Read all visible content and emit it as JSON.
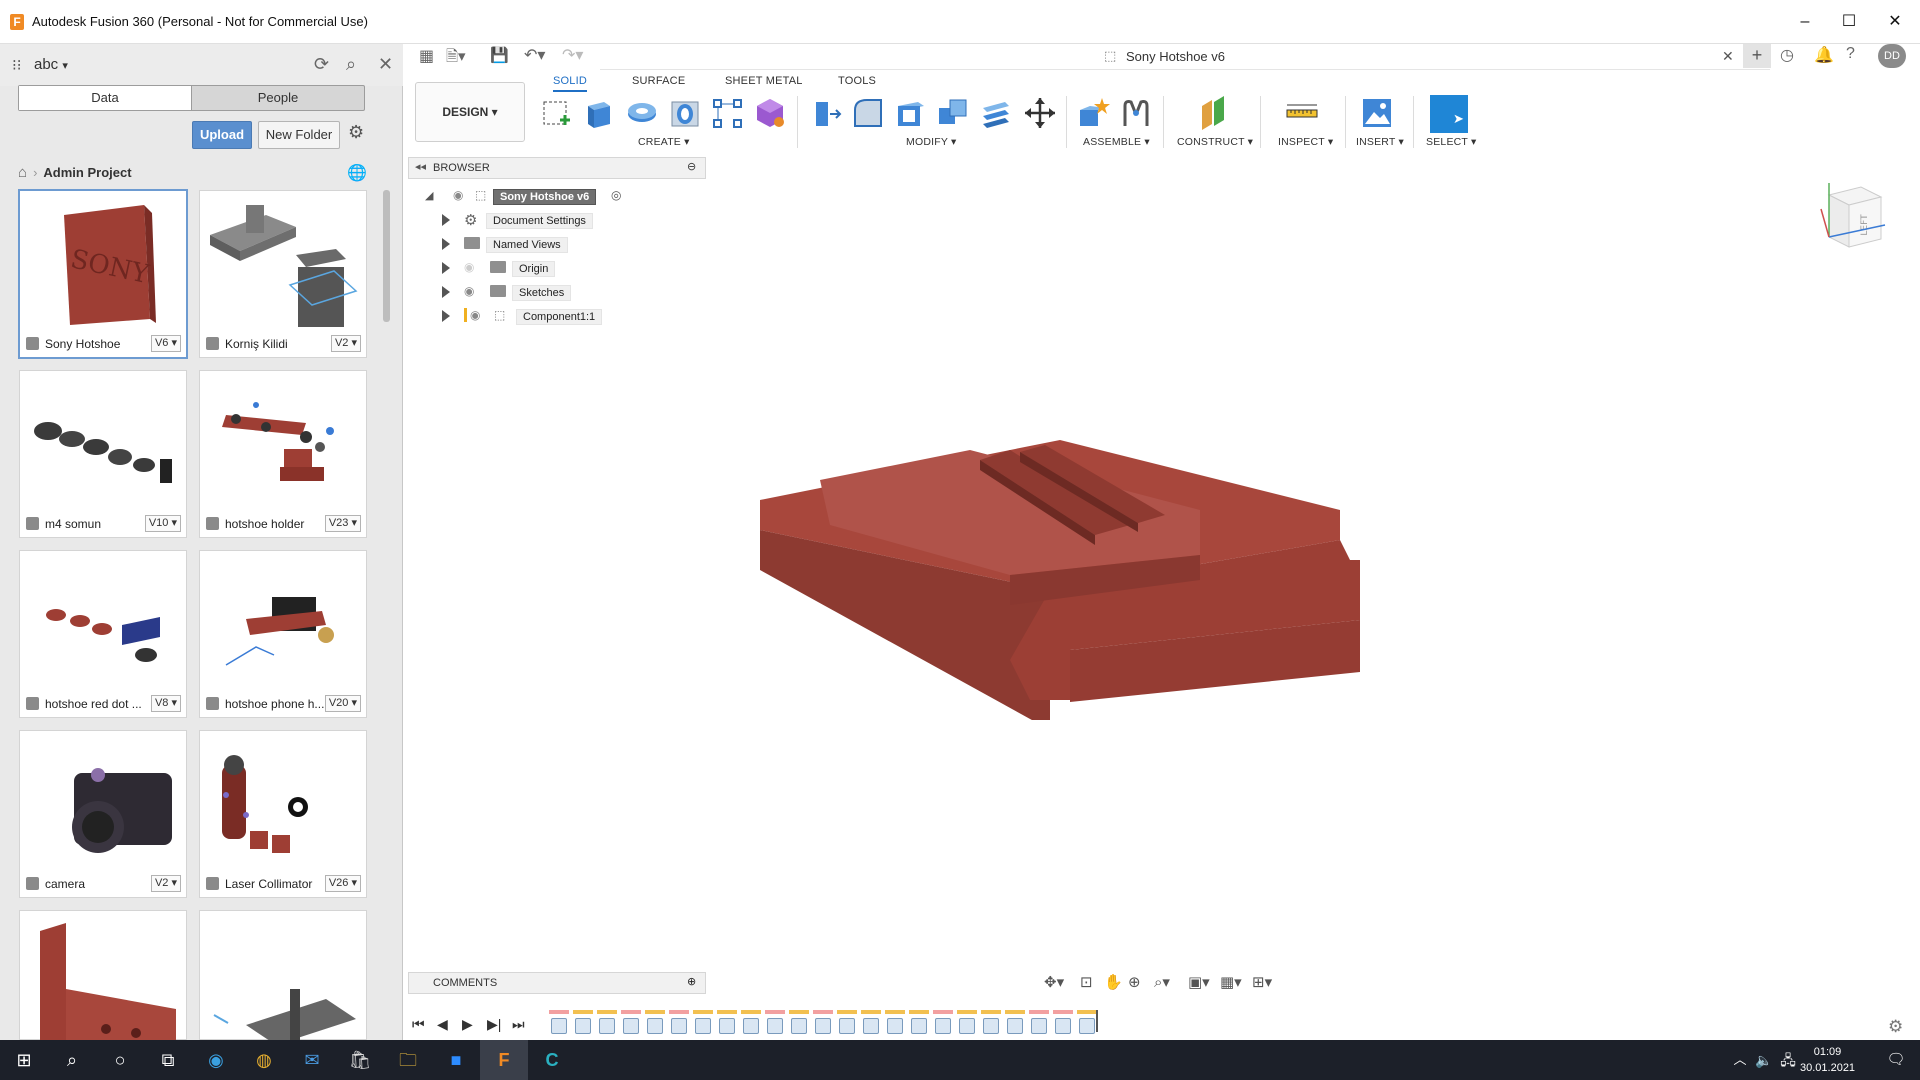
{
  "window": {
    "title": "Autodesk Fusion 360 (Personal - Not for Commercial Use)",
    "app_icon": "F",
    "minimize": "–",
    "maximize": "☐",
    "close": "✕"
  },
  "data_panel": {
    "hub_name": "abc",
    "tabs": [
      "Data",
      "People"
    ],
    "upload_label": "Upload",
    "new_folder_label": "New Folder",
    "breadcrumb_project": "Admin Project",
    "files": [
      {
        "name": "Sony Hotshoe",
        "version": "V6"
      },
      {
        "name": "Korniş Kilidi",
        "version": "V2"
      },
      {
        "name": "m4 somun",
        "version": "V10"
      },
      {
        "name": "hotshoe holder",
        "version": "V23"
      },
      {
        "name": "hotshoe red dot ...",
        "version": "V8"
      },
      {
        "name": "hotshoe phone h...",
        "version": "V20"
      },
      {
        "name": "camera",
        "version": "V2"
      },
      {
        "name": "Laser Collimator",
        "version": "V26"
      }
    ]
  },
  "document": {
    "title": "Sony Hotshoe v6",
    "avatar_initials": "DD"
  },
  "toolbar": {
    "workspace": "DESIGN",
    "tabs": [
      "SOLID",
      "SURFACE",
      "SHEET METAL",
      "TOOLS"
    ],
    "active_tab": "SOLID",
    "groups": [
      "CREATE",
      "MODIFY",
      "ASSEMBLE",
      "CONSTRUCT",
      "INSPECT",
      "INSERT",
      "SELECT"
    ]
  },
  "browser": {
    "title": "BROWSER",
    "root": "Sony Hotshoe v6",
    "items": [
      "Document Settings",
      "Named Views",
      "Origin",
      "Sketches",
      "Component1:1"
    ]
  },
  "comments": {
    "title": "COMMENTS"
  },
  "viewcube": {
    "face": "LEFT"
  },
  "taskbar": {
    "time": "01:09",
    "date": "30.01.2021"
  },
  "colors": {
    "model_red": "#a8473c",
    "accent_blue": "#1f6fc5",
    "upload_blue": "#5a8fcf"
  }
}
